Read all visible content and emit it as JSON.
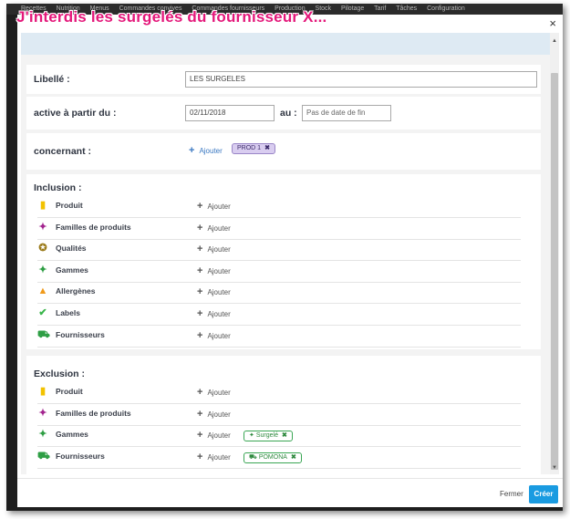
{
  "annotation_title": "J'interdis les surgelés du fournisseur X...",
  "topnav": [
    "Recettes",
    "Nutrition",
    "Menus",
    "Commandes convives",
    "Commandes fournisseurs",
    "Production",
    "Stock",
    "Pilotage",
    "Tarif",
    "Tâches",
    "Configuration"
  ],
  "close_label": "×",
  "form": {
    "libelle_label": "Libellé :",
    "libelle_value": "LES SURGELES",
    "active_label": "active à partir du :",
    "date_start": "02/11/2018",
    "au_label": "au :",
    "date_end_placeholder": "Pas de date de fin",
    "concernant_label": "concernant :",
    "add_label": "Ajouter",
    "concernant_tag": "PROD 1"
  },
  "inclusion": {
    "title": "Inclusion :",
    "rows": [
      {
        "label": "Produit",
        "icon": "product-icon",
        "color": "#f2c200",
        "glyph": "▮"
      },
      {
        "label": "Familles de produits",
        "icon": "families-icon",
        "color": "#a3248f",
        "glyph": "✦"
      },
      {
        "label": "Qualités",
        "icon": "quality-icon",
        "color": "#9a7a1a",
        "glyph": "✪"
      },
      {
        "label": "Gammes",
        "icon": "ranges-icon",
        "color": "#2e9e44",
        "glyph": "✦"
      },
      {
        "label": "Allergènes",
        "icon": "allergen-icon",
        "color": "#f09a1a",
        "glyph": "▲"
      },
      {
        "label": "Labels",
        "icon": "labels-icon",
        "color": "#39b54a",
        "glyph": "✔"
      },
      {
        "label": "Fournisseurs",
        "icon": "supplier-icon",
        "color": "#2e9e44",
        "glyph": "⛟"
      }
    ],
    "add_label": "Ajouter"
  },
  "exclusion": {
    "title": "Exclusion :",
    "rows": [
      {
        "label": "Produit",
        "icon": "product-icon",
        "color": "#f2c200",
        "glyph": "▮",
        "tag": ""
      },
      {
        "label": "Familles de produits",
        "icon": "families-icon",
        "color": "#a3248f",
        "glyph": "✦",
        "tag": ""
      },
      {
        "label": "Gammes",
        "icon": "ranges-icon",
        "color": "#2e9e44",
        "glyph": "✦",
        "tag": "Surgelé"
      },
      {
        "label": "Fournisseurs",
        "icon": "supplier-icon",
        "color": "#2e9e44",
        "glyph": "⛟",
        "tag": "POMONA"
      }
    ],
    "add_label": "Ajouter"
  },
  "footer": {
    "close_button": "Fermer",
    "create_button": "Créer"
  }
}
